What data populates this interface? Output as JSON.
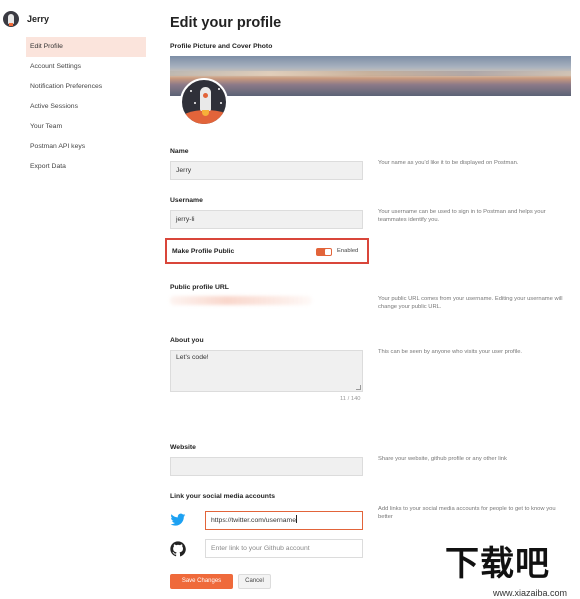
{
  "user": {
    "name": "Jerry"
  },
  "sidebar": {
    "items": [
      {
        "label": "Edit Profile",
        "active": true
      },
      {
        "label": "Account Settings",
        "active": false
      },
      {
        "label": "Notification Preferences",
        "active": false
      },
      {
        "label": "Active Sessions",
        "active": false
      },
      {
        "label": "Your Team",
        "active": false
      },
      {
        "label": "Postman API keys",
        "active": false
      },
      {
        "label": "Export Data",
        "active": false
      }
    ]
  },
  "page": {
    "title": "Edit your profile"
  },
  "profile_picture": {
    "label": "Profile Picture and Cover Photo"
  },
  "name": {
    "label": "Name",
    "value": "Jerry",
    "hint": "Your name as you'd like it to be displayed on Postman."
  },
  "username": {
    "label": "Username",
    "value": "jerry-li",
    "hint": "Your username can be used to sign in to Postman and helps your teammates identify you."
  },
  "public_profile": {
    "label": "Make Profile Public",
    "status": "Enabled",
    "enabled": true
  },
  "public_url": {
    "label": "Public profile URL",
    "hint": "Your public URL comes from your username. Editing your username will change your public URL."
  },
  "about": {
    "label": "About you",
    "value": "Let's code!",
    "counter": "11 / 140",
    "hint": "This can be seen by anyone who visits your user profile."
  },
  "website": {
    "label": "Website",
    "value": "",
    "hint": "Share your website, github profile or any other link"
  },
  "social": {
    "label": "Link your social media accounts",
    "hint": "Add links to your social media accounts for people to get to know you better",
    "twitter": {
      "icon": "twitter-icon",
      "value": "https://twitter.com/username"
    },
    "github": {
      "icon": "github-icon",
      "placeholder": "Enter link to your Github account"
    }
  },
  "actions": {
    "save": "Save Changes",
    "cancel": "Cancel"
  },
  "watermark": {
    "title": "下载吧",
    "url": "www.xiazaiba.com"
  },
  "colors": {
    "accent": "#ef6a3b",
    "highlight_border": "#d9463a",
    "active_nav_bg": "#fbe4dc",
    "twitter": "#1da1f2"
  }
}
